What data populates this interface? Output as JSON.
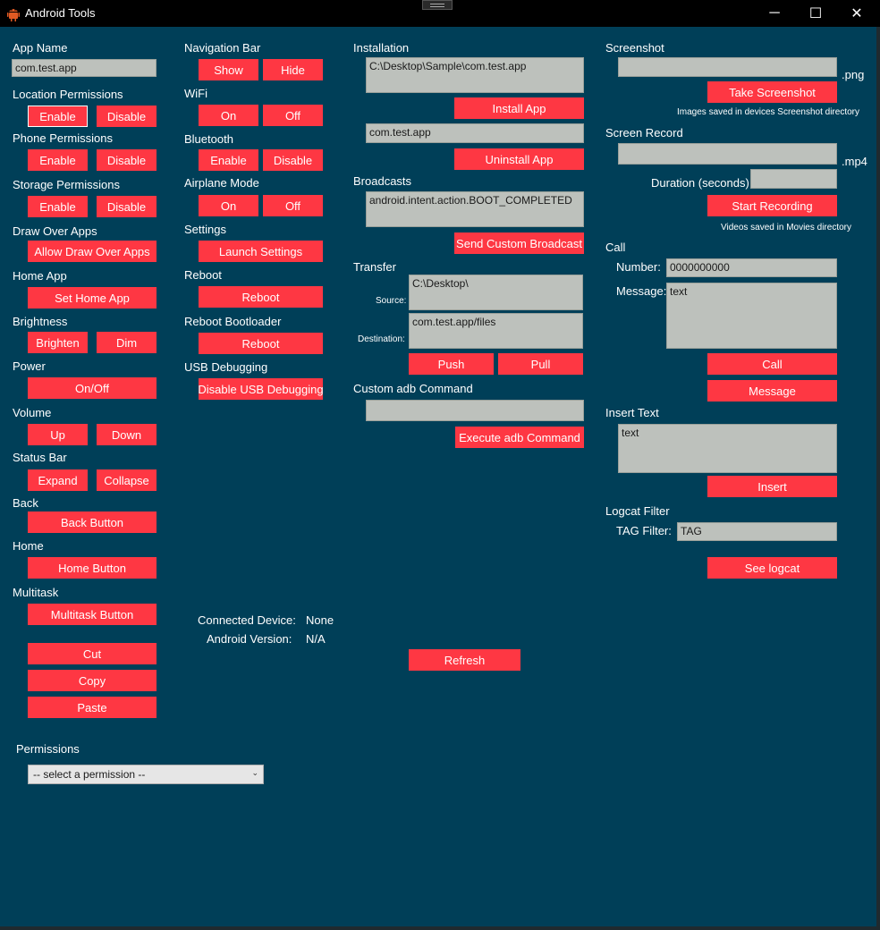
{
  "window": {
    "title": "Android Tools",
    "minimize_icon": "─",
    "maximize_icon": "☐",
    "close_icon": "✕"
  },
  "col1": {
    "app_name_label": "App Name",
    "app_name_value": "com.test.app",
    "location_label": "Location Permissions",
    "location_enable": "Enable",
    "location_disable": "Disable",
    "phone_label": "Phone Permissions",
    "phone_enable": "Enable",
    "phone_disable": "Disable",
    "storage_label": "Storage Permissions",
    "storage_enable": "Enable",
    "storage_disable": "Disable",
    "draw_label": "Draw Over Apps",
    "draw_button": "Allow Draw Over Apps",
    "home_app_label": "Home App",
    "home_app_button": "Set Home App",
    "brightness_label": "Brightness",
    "brighten_button": "Brighten",
    "dim_button": "Dim",
    "power_label": "Power",
    "power_button": "On/Off",
    "volume_label": "Volume",
    "volume_up": "Up",
    "volume_down": "Down",
    "status_bar_label": "Status Bar",
    "expand_button": "Expand",
    "collapse_button": "Collapse",
    "back_label": "Back",
    "back_button": "Back Button",
    "home_label": "Home",
    "home_button": "Home Button",
    "multitask_label": "Multitask",
    "multitask_button": "Multitask Button",
    "cut_button": "Cut",
    "copy_button": "Copy",
    "paste_button": "Paste",
    "permissions_label": "Permissions",
    "permissions_select": "-- select a permission --"
  },
  "col2": {
    "nav_bar_label": "Navigation Bar",
    "nav_show": "Show",
    "nav_hide": "Hide",
    "wifi_label": "WiFi",
    "wifi_on": "On",
    "wifi_off": "Off",
    "bluetooth_label": "Bluetooth",
    "bt_enable": "Enable",
    "bt_disable": "Disable",
    "airplane_label": "Airplane Mode",
    "airplane_on": "On",
    "airplane_off": "Off",
    "settings_label": "Settings",
    "settings_button": "Launch Settings",
    "reboot_label": "Reboot",
    "reboot_button": "Reboot",
    "bootloader_label": "Reboot Bootloader",
    "bootloader_button": "Reboot",
    "usb_label": "USB Debugging",
    "usb_button": "Disable USB Debugging",
    "connected_label": "Connected Device:",
    "connected_value": "None",
    "android_label": "Android Version:",
    "android_value": "N/A"
  },
  "col3": {
    "installation_label": "Installation",
    "install_path": "C:\\Desktop\\Sample\\com.test.app",
    "install_button": "Install App",
    "uninstall_value": "com.test.app",
    "uninstall_button": "Uninstall App",
    "broadcasts_label": "Broadcasts",
    "broadcast_value": "android.intent.action.BOOT_COMPLETED",
    "broadcast_button": "Send Custom Broadcast",
    "transfer_label": "Transfer",
    "source_label": "Source:",
    "source_value": "C:\\Desktop\\",
    "destination_label": "Destination:",
    "destination_value": "com.test.app/files",
    "push_button": "Push",
    "pull_button": "Pull",
    "adb_label": "Custom adb Command",
    "adb_value": "",
    "adb_button": "Execute adb Command",
    "refresh_button": "Refresh"
  },
  "col4": {
    "screenshot_label": "Screenshot",
    "screenshot_value": "",
    "png_ext": ".png",
    "screenshot_button": "Take Screenshot",
    "screenshot_note": "Images saved in devices Screenshot directory",
    "record_label": "Screen Record",
    "record_value": "",
    "mp4_ext": ".mp4",
    "duration_label": "Duration (seconds):",
    "duration_value": "",
    "record_button": "Start Recording",
    "record_note": "Videos saved in Movies directory",
    "call_label": "Call",
    "number_label": "Number:",
    "number_value": "0000000000",
    "message_label": "Message:",
    "message_value": "text",
    "call_button": "Call",
    "message_button": "Message",
    "insert_label": "Insert Text",
    "insert_value": "text",
    "insert_button": "Insert",
    "logcat_label": "Logcat Filter",
    "tag_label": "TAG Filter:",
    "tag_value": "TAG",
    "logcat_button": "See logcat"
  }
}
